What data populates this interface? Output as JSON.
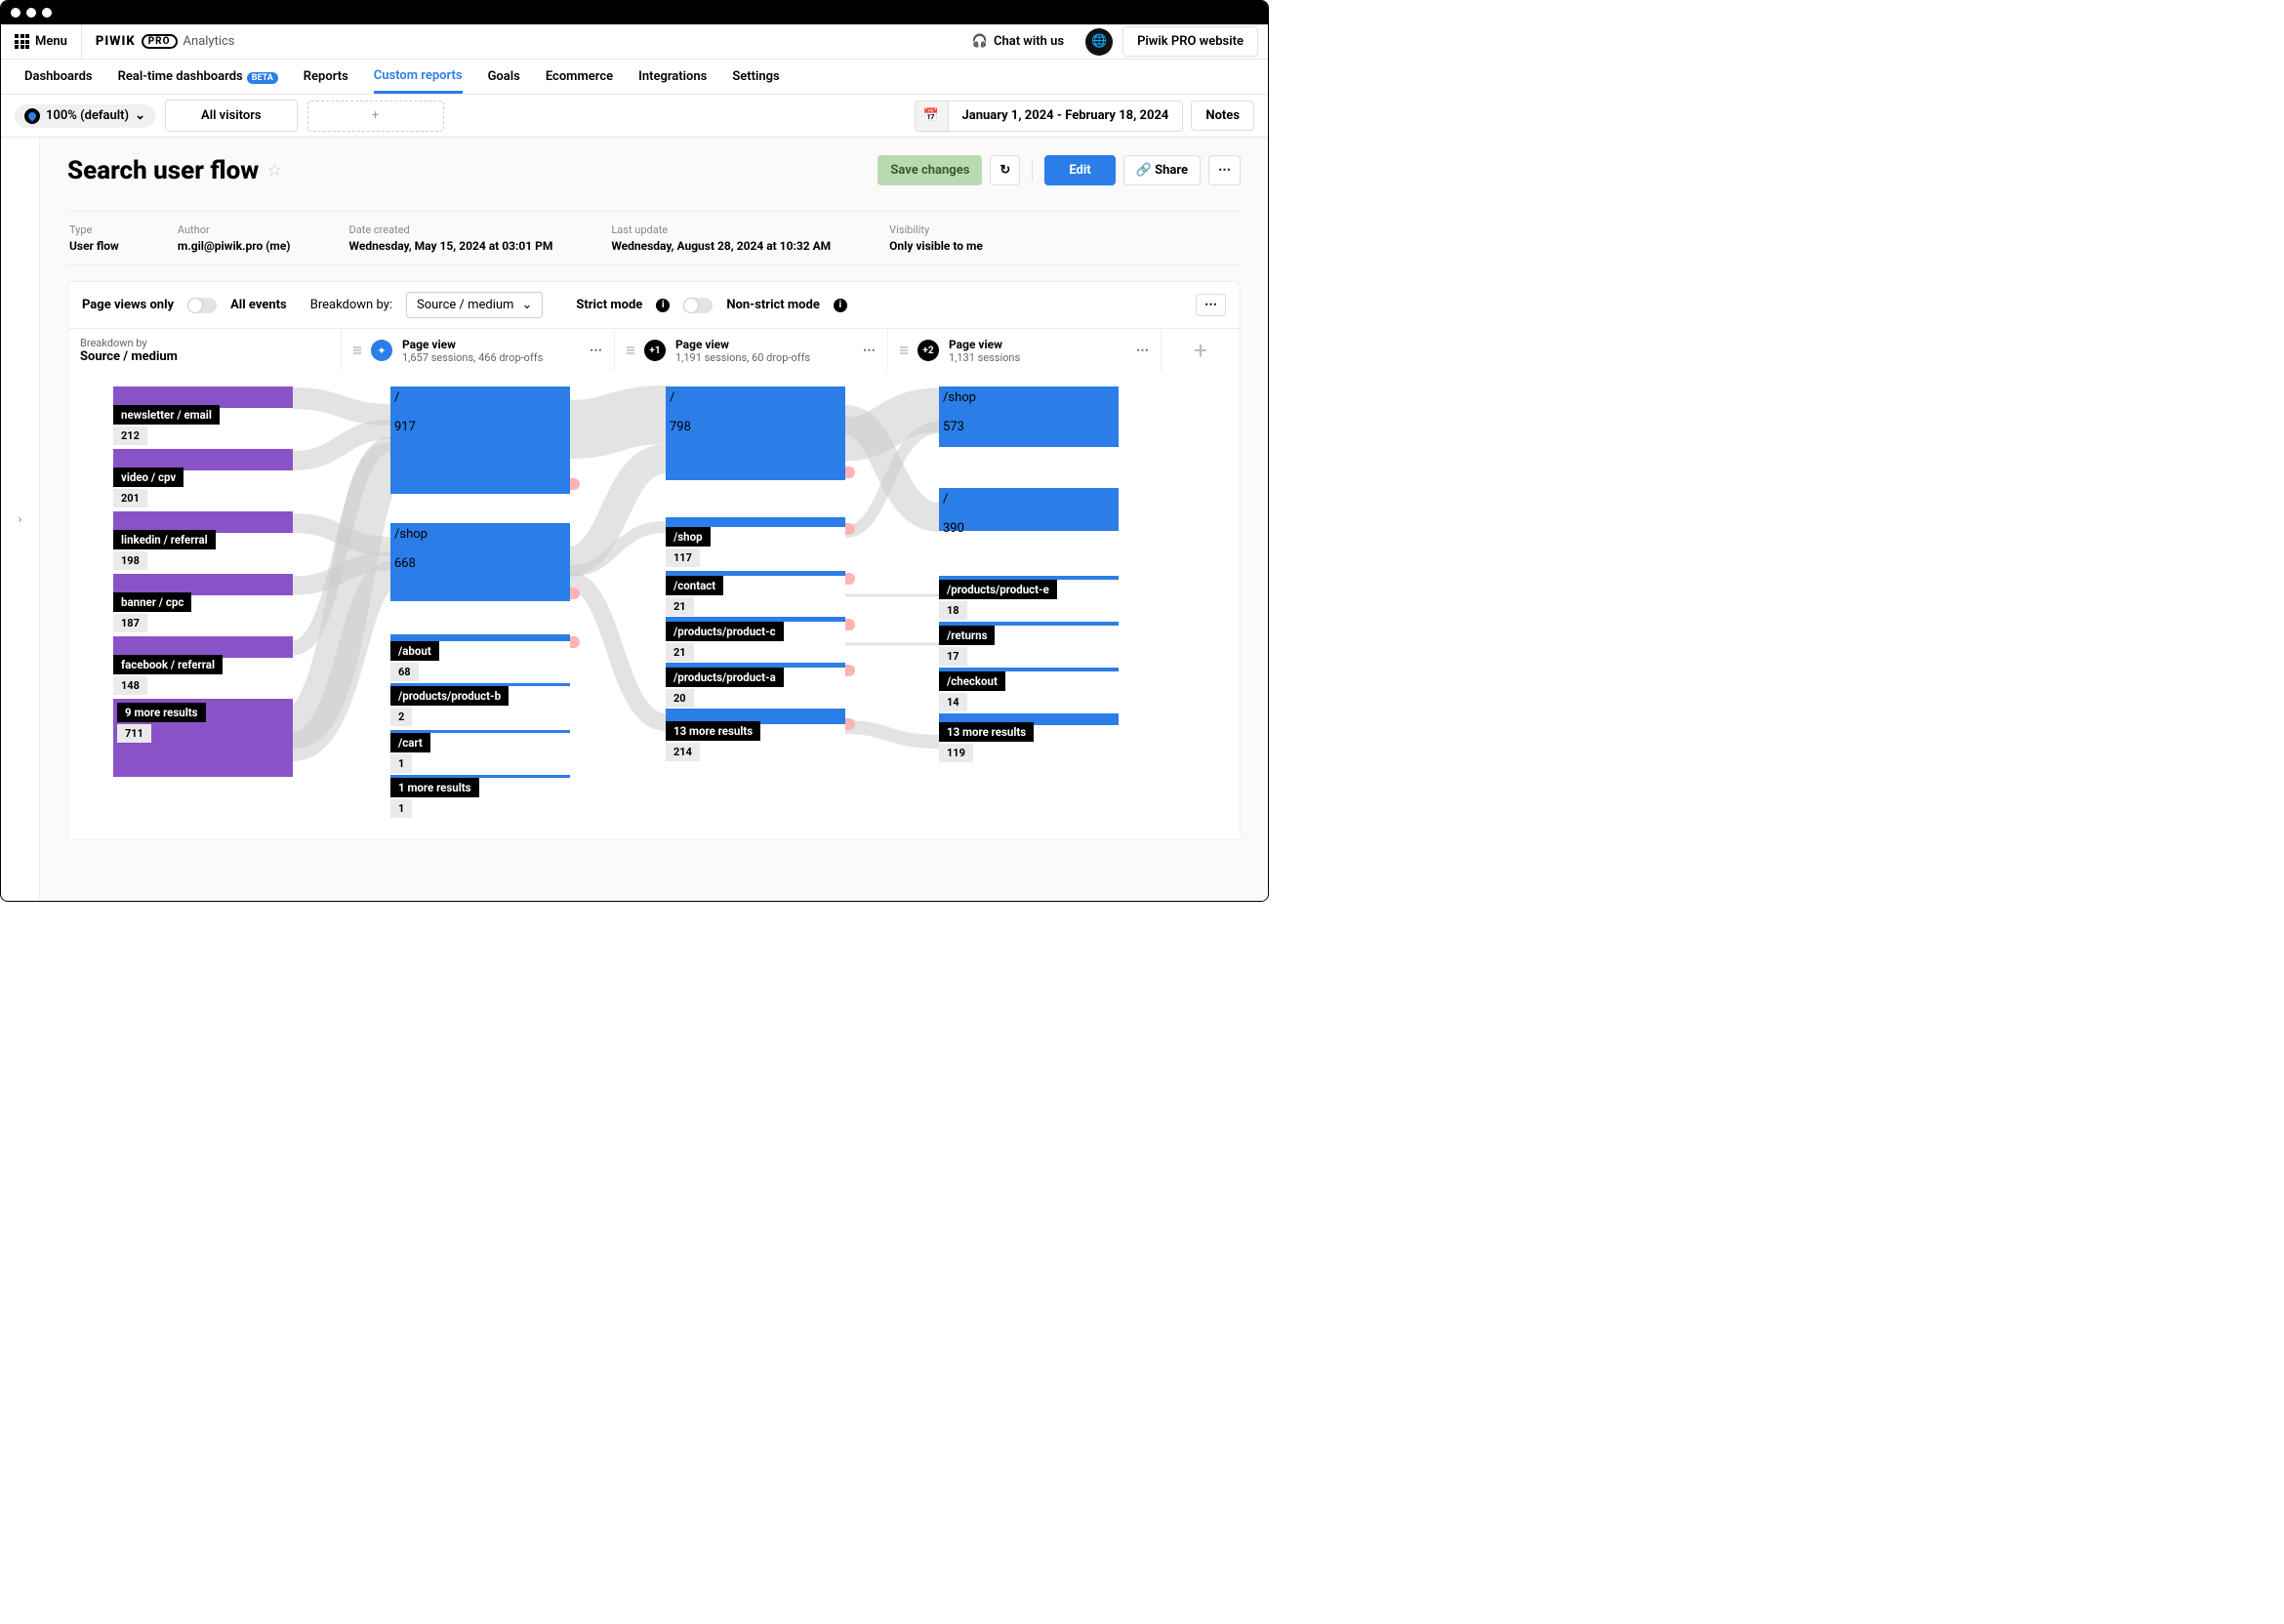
{
  "menu_label": "Menu",
  "brand": {
    "name": "PIWIK",
    "pro": "PRO",
    "suite": "Analytics"
  },
  "chat": "Chat with us",
  "site": "Piwik PRO website",
  "nav": {
    "dash": "Dashboards",
    "rt": "Real-time dashboards",
    "beta": "BETA",
    "reports": "Reports",
    "custom": "Custom reports",
    "goals": "Goals",
    "ecom": "Ecommerce",
    "integ": "Integrations",
    "settings": "Settings"
  },
  "sampling": "100% (default)",
  "segment": "All visitors",
  "date_range": "January 1, 2024 - February 18, 2024",
  "notes": "Notes",
  "page_title": "Search user flow",
  "actions": {
    "save": "Save changes",
    "edit": "Edit",
    "share": "Share"
  },
  "meta": {
    "type": {
      "lbl": "Type",
      "val": "User flow"
    },
    "author": {
      "lbl": "Author",
      "val": "m.gil@piwik.pro (me)"
    },
    "created": {
      "lbl": "Date created",
      "val": "Wednesday, May 15, 2024 at 03:01 PM"
    },
    "updated": {
      "lbl": "Last update",
      "val": "Wednesday, August 28, 2024 at 10:32 AM"
    },
    "vis": {
      "lbl": "Visibility",
      "val": "Only visible to me"
    }
  },
  "controls": {
    "pv_only": "Page views only",
    "all_ev": "All events",
    "breakdown_by_lbl": "Breakdown by:",
    "breakdown_sel": "Source / medium",
    "strict": "Strict mode",
    "nonstrict": "Non-strict mode"
  },
  "breakdown": {
    "lbl": "Breakdown by",
    "val": "Source / medium"
  },
  "steps": [
    {
      "title": "Page view",
      "sub": "1,657 sessions, 466 drop-offs",
      "badge": "compass"
    },
    {
      "title": "Page view",
      "sub": "1,191 sessions, 60 drop-offs",
      "badge": "+1"
    },
    {
      "title": "Page view",
      "sub": "1,131 sessions",
      "badge": "+2"
    }
  ],
  "chart_data": {
    "type": "sankey",
    "steps": [
      {
        "name": "Source / medium",
        "nodes": [
          {
            "label": "newsletter / email",
            "value": 212
          },
          {
            "label": "video / cpv",
            "value": 201
          },
          {
            "label": "linkedin / referral",
            "value": 198
          },
          {
            "label": "banner / cpc",
            "value": 187
          },
          {
            "label": "facebook / referral",
            "value": 148
          },
          {
            "label": "9 more results",
            "value": 711
          }
        ]
      },
      {
        "name": "Page view 1",
        "sessions": 1657,
        "dropoffs": 466,
        "nodes": [
          {
            "label": "/",
            "value": 917
          },
          {
            "label": "/shop",
            "value": 668
          },
          {
            "label": "/about",
            "value": 68
          },
          {
            "label": "/products/product-b",
            "value": 2
          },
          {
            "label": "/cart",
            "value": 1
          },
          {
            "label": "1 more results",
            "value": 1
          }
        ]
      },
      {
        "name": "Page view 2",
        "sessions": 1191,
        "dropoffs": 60,
        "nodes": [
          {
            "label": "/",
            "value": 798
          },
          {
            "label": "/shop",
            "value": 117
          },
          {
            "label": "/contact",
            "value": 21
          },
          {
            "label": "/products/product-c",
            "value": 21
          },
          {
            "label": "/products/product-a",
            "value": 20
          },
          {
            "label": "13 more results",
            "value": 214
          }
        ]
      },
      {
        "name": "Page view 3",
        "sessions": 1131,
        "nodes": [
          {
            "label": "/shop",
            "value": 573
          },
          {
            "label": "/",
            "value": 390
          },
          {
            "label": "/products/product-e",
            "value": 18
          },
          {
            "label": "/returns",
            "value": 17
          },
          {
            "label": "/checkout",
            "value": 14
          },
          {
            "label": "13 more results",
            "value": 119
          }
        ]
      }
    ]
  }
}
